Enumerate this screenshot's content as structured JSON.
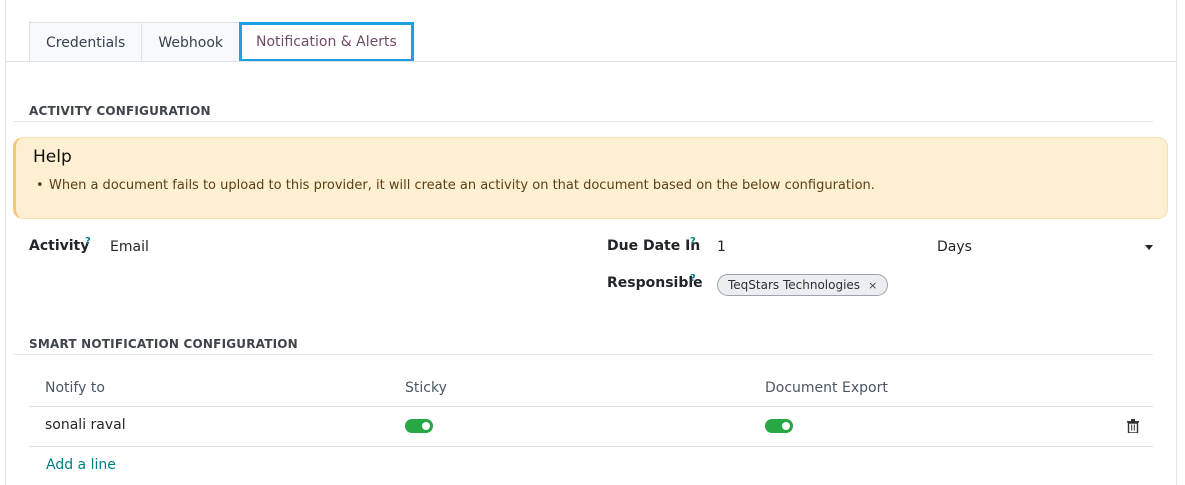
{
  "tabs": [
    {
      "label": "Credentials"
    },
    {
      "label": "Webhook"
    },
    {
      "label": "Notification & Alerts"
    }
  ],
  "activity_section": {
    "title": "ACTIVITY CONFIGURATION",
    "help": {
      "title": "Help",
      "items": [
        "When a document fails to upload to this provider, it will create an activity on that document based on the below configuration."
      ]
    },
    "activity": {
      "label": "Activity",
      "help_mark": "?",
      "value": "Email"
    },
    "due_date": {
      "label": "Due Date In",
      "help_mark": "?",
      "value": "1",
      "unit": "Days"
    },
    "responsible": {
      "label": "Responsible",
      "help_mark": "?",
      "tag": "TeqStars Technologies",
      "remove": "×"
    }
  },
  "smart_section": {
    "title": "SMART NOTIFICATION CONFIGURATION",
    "columns": [
      "Notify to",
      "Sticky",
      "Document Export"
    ],
    "rows": [
      {
        "notify_to": "sonali raval",
        "sticky": true,
        "document_export": true
      }
    ],
    "add_line": "Add a line"
  },
  "colors": {
    "accent": "#017e84",
    "active_tab_border": "#1ba1e2",
    "toggle_on": "#28a745",
    "help_bg": "#fcefd2"
  }
}
